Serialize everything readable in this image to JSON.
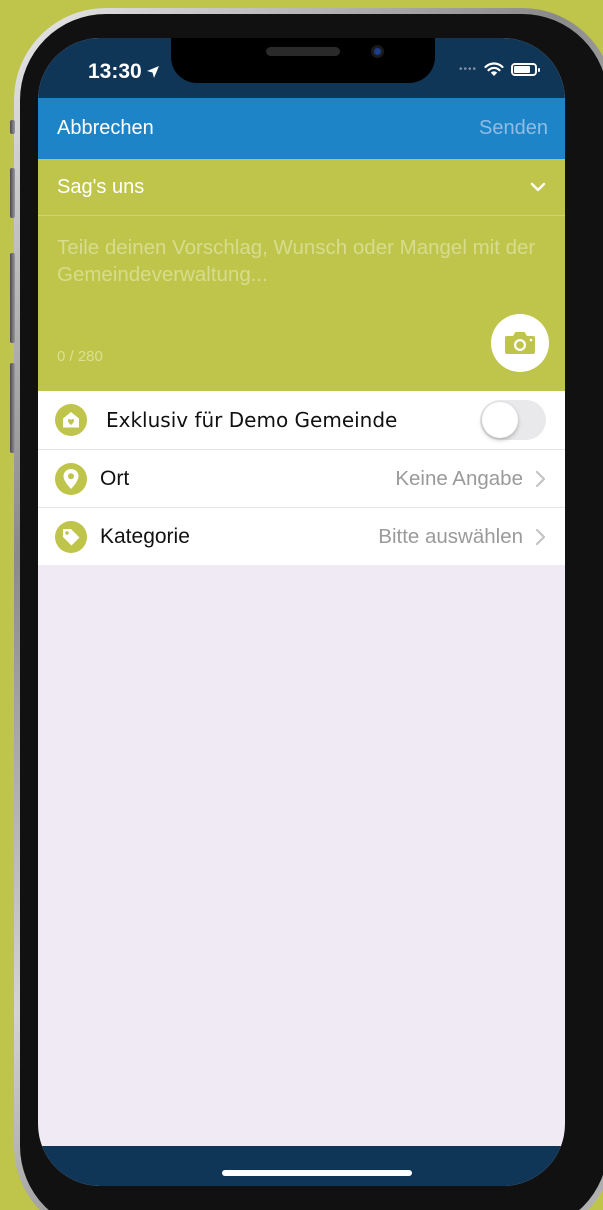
{
  "status_bar": {
    "time": "13:30",
    "location_icon": "location-arrow-icon",
    "wifi_icon": "wifi-icon",
    "battery_icon": "battery-icon"
  },
  "navbar": {
    "cancel_label": "Abbrechen",
    "send_label": "Senden"
  },
  "composer": {
    "type_label": "Sag's uns",
    "placeholder": "Teile deinen Vorschlag, Wunsch oder Mangel mit der Gemeindeverwaltung...",
    "counter": "0 / 280",
    "camera_icon": "camera-icon"
  },
  "list": {
    "exclusive": {
      "label": "Exklusiv für Demo Gemeinde",
      "enabled": false
    },
    "location": {
      "label": "Ort",
      "value": "Keine Angabe"
    },
    "category": {
      "label": "Kategorie",
      "value": "Bitte auswählen"
    }
  },
  "colors": {
    "brand_green": "#bfc44b",
    "nav_blue": "#1e84c8",
    "dark_navy": "#0f3557",
    "background": "#efeaf4"
  }
}
